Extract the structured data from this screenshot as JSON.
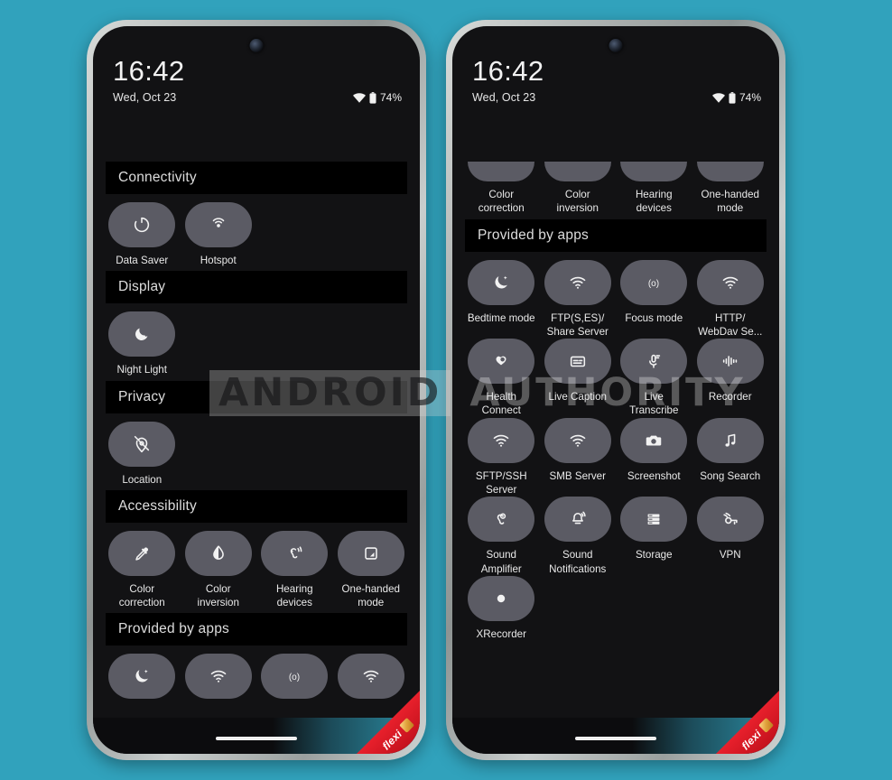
{
  "background_color": "#31a2bc",
  "watermark": {
    "word1": "ANDROID",
    "word2": "AUTHORITY"
  },
  "ribbon": {
    "label": "flexi"
  },
  "status_bar": {
    "time": "16:42",
    "date": "Wed, Oct 23",
    "battery": "74%",
    "wifi_icon": "wifi-icon",
    "battery_icon": "battery-icon"
  },
  "phone_left": {
    "sections": [
      {
        "header": "Connectivity",
        "tiles": [
          {
            "label": "Data Saver",
            "icon": "data-saver-icon"
          },
          {
            "label": "Hotspot",
            "icon": "hotspot-icon"
          }
        ]
      },
      {
        "header": "Display",
        "tiles": [
          {
            "label": "Night Light",
            "icon": "moon-icon"
          }
        ]
      },
      {
        "header": "Privacy",
        "tiles": [
          {
            "label": "Location",
            "icon": "location-off-icon"
          }
        ]
      },
      {
        "header": "Accessibility",
        "tiles": [
          {
            "label": "Color correction",
            "icon": "eyedropper-icon"
          },
          {
            "label": "Color inversion",
            "icon": "contrast-droplet-icon"
          },
          {
            "label": "Hearing devices",
            "icon": "hearing-icon"
          },
          {
            "label": "One-handed mode",
            "icon": "one-handed-icon"
          }
        ]
      },
      {
        "header": "Provided by apps",
        "tiles": [
          {
            "label": "",
            "icon": "bedtime-icon"
          },
          {
            "label": "",
            "icon": "wifi-icon"
          },
          {
            "label": "",
            "icon": "focus-mode-icon"
          },
          {
            "label": "",
            "icon": "wifi-icon"
          }
        ]
      }
    ]
  },
  "phone_right": {
    "clipped_row": [
      {
        "label": "Color correction",
        "icon": "eyedropper-icon"
      },
      {
        "label": "Color inversion",
        "icon": "contrast-droplet-icon"
      },
      {
        "label": "Hearing devices",
        "icon": "hearing-icon"
      },
      {
        "label": "One-handed mode",
        "icon": "one-handed-icon"
      }
    ],
    "sections": [
      {
        "header": "Provided by apps",
        "tiles": [
          {
            "label": "Bedtime mode",
            "icon": "bedtime-icon"
          },
          {
            "label": "FTP(S,ES)/ Share Server",
            "icon": "wifi-icon"
          },
          {
            "label": "Focus mode",
            "icon": "focus-mode-icon"
          },
          {
            "label": "HTTP/ WebDav Se...",
            "icon": "wifi-icon"
          },
          {
            "label": "Health Connect",
            "icon": "health-connect-icon"
          },
          {
            "label": "Live Caption",
            "icon": "live-caption-icon"
          },
          {
            "label": "Live Transcribe",
            "icon": "live-transcribe-icon"
          },
          {
            "label": "Recorder",
            "icon": "waveform-icon"
          },
          {
            "label": "SFTP/SSH Server",
            "icon": "wifi-icon"
          },
          {
            "label": "SMB Server",
            "icon": "wifi-icon"
          },
          {
            "label": "Screenshot",
            "icon": "camera-icon"
          },
          {
            "label": "Song Search",
            "icon": "music-note-icon"
          },
          {
            "label": "Sound Amplifier",
            "icon": "sound-amplifier-icon"
          },
          {
            "label": "Sound Notifications",
            "icon": "bell-icon"
          },
          {
            "label": "Storage",
            "icon": "storage-icon"
          },
          {
            "label": "VPN",
            "icon": "vpn-key-icon"
          },
          {
            "label": "XRecorder",
            "icon": "record-dot-icon"
          }
        ]
      }
    ]
  }
}
